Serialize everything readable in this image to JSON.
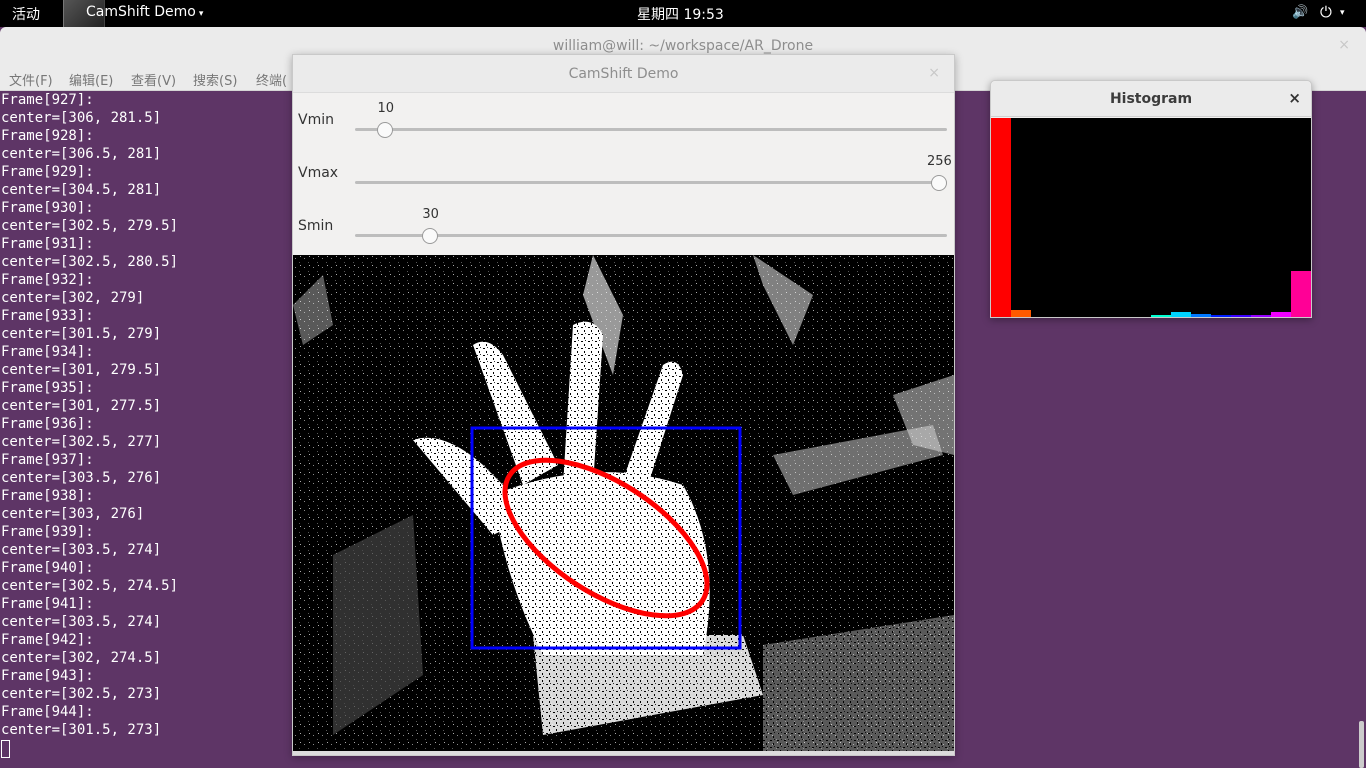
{
  "topbar": {
    "activities": "活动",
    "app_menu": "CamShift Demo",
    "app_menu_arrow": "▾",
    "clock": "星期四 19:53",
    "volume_icon": "🔊",
    "power_icon": "⏻",
    "power_arrow": "▾"
  },
  "terminal": {
    "title": "william@will: ~/workspace/AR_Drone",
    "close": "×",
    "menu": [
      "文件(F)",
      "编辑(E)",
      "查看(V)",
      "搜索(S)",
      "终端("
    ],
    "lines": [
      "Frame[927]:",
      "center=[306, 281.5]",
      "Frame[928]:",
      "center=[306.5, 281]",
      "Frame[929]:",
      "center=[304.5, 281]",
      "Frame[930]:",
      "center=[302.5, 279.5]",
      "Frame[931]:",
      "center=[302.5, 280.5]",
      "Frame[932]:",
      "center=[302, 279]",
      "Frame[933]:",
      "center=[301.5, 279]",
      "Frame[934]:",
      "center=[301, 279.5]",
      "Frame[935]:",
      "center=[301, 277.5]",
      "Frame[936]:",
      "center=[302.5, 277]",
      "Frame[937]:",
      "center=[303.5, 276]",
      "Frame[938]:",
      "center=[303, 276]",
      "Frame[939]:",
      "center=[303.5, 274]",
      "Frame[940]:",
      "center=[302.5, 274.5]",
      "Frame[941]:",
      "center=[303.5, 274]",
      "Frame[942]:",
      "center=[302, 274.5]",
      "Frame[943]:",
      "center=[302.5, 273]",
      "Frame[944]:",
      "center=[301.5, 273]"
    ]
  },
  "camshift": {
    "title": "CamShift Demo",
    "close": "×",
    "sliders": [
      {
        "label": "Vmin",
        "value": "10",
        "fraction": 0.039
      },
      {
        "label": "Vmax",
        "value": "256",
        "fraction": 1.0
      },
      {
        "label": "Smin",
        "value": "30",
        "fraction": 0.117
      }
    ],
    "track_box_color": "#0000ff",
    "track_ellipse_color": "#ff0000"
  },
  "histogram": {
    "title": "Histogram",
    "close": "×",
    "bins": [
      {
        "color": "#ff0000",
        "value": 1.0
      },
      {
        "color": "#ff5a00",
        "value": 0.035
      },
      {
        "color": "#ffb400",
        "value": 0.0
      },
      {
        "color": "#f0ff00",
        "value": 0.0
      },
      {
        "color": "#96ff00",
        "value": 0.0
      },
      {
        "color": "#3cff00",
        "value": 0.0
      },
      {
        "color": "#00ff1e",
        "value": 0.0
      },
      {
        "color": "#00ff78",
        "value": 0.0
      },
      {
        "color": "#00ffd2",
        "value": 0.01
      },
      {
        "color": "#00d2ff",
        "value": 0.025
      },
      {
        "color": "#0078ff",
        "value": 0.015
      },
      {
        "color": "#001eff",
        "value": 0.01
      },
      {
        "color": "#3c00ff",
        "value": 0.008
      },
      {
        "color": "#9600ff",
        "value": 0.01
      },
      {
        "color": "#f000ff",
        "value": 0.025
      },
      {
        "color": "#ff0096",
        "value": 0.23
      }
    ]
  }
}
